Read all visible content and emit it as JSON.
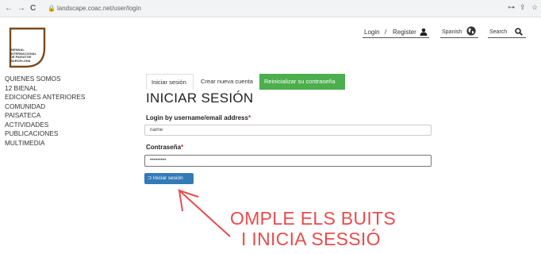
{
  "browser": {
    "url": "landscape.coac.net/user/login",
    "back_glyph": "←",
    "forward_glyph": "→",
    "reload_glyph": "C",
    "lock_glyph": "🔒",
    "key_glyph": "⊶",
    "share_glyph": "⇪",
    "star_glyph": "☆"
  },
  "logo": {
    "text": "BIENNAL\nINTERNACIONAL\nDE PAISATGE\nBARCELONA",
    "color": "#7a4a1e"
  },
  "sidebar": {
    "items": [
      {
        "label": "QUIENES SOMOS"
      },
      {
        "label": "12 BIENAL"
      },
      {
        "label": "EDICIONES ANTERIORES"
      },
      {
        "label": "COMUNIDAD"
      },
      {
        "label": "PAISATECA"
      },
      {
        "label": "ACTIVIDADES"
      },
      {
        "label": "PUBLICACIONES"
      },
      {
        "label": "MULTIMEDIA"
      }
    ]
  },
  "topnav": {
    "login": "Login",
    "separator": "/",
    "register": "Register",
    "language": "Spanish",
    "search": "Search"
  },
  "tabs": [
    {
      "label": "Iniciar sesión"
    },
    {
      "label": "Crear nueva cuenta"
    },
    {
      "label": "Reinicializar su contraseña"
    }
  ],
  "form": {
    "title": "INICIAR SESIÓN",
    "username_label": "Login by username/email address",
    "username_value": "name",
    "password_label": "Contraseña",
    "password_value": "•••••••••",
    "required_mark": "*",
    "submit_label": "Iniciar sesión",
    "submit_icon": "⮊"
  },
  "annotation": {
    "line1": "OMPLE ELS BUITS",
    "line2": "I INICIA SESSIÓ",
    "color": "#e84c4c"
  }
}
